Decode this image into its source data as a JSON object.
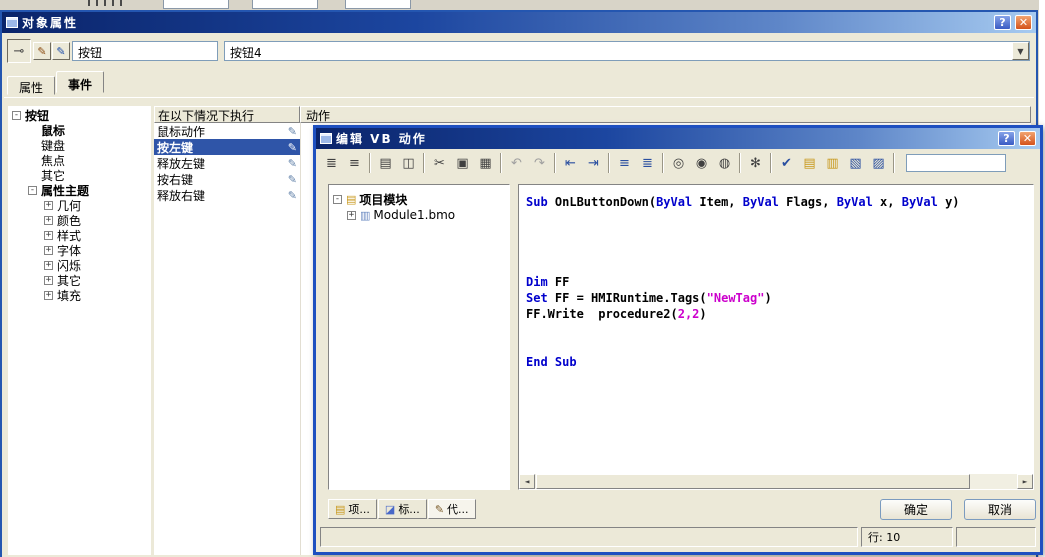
{
  "colors": {
    "titlebar_gradient_start": "#0A246A",
    "titlebar_gradient_end": "#A6CAF0",
    "selection_blue": "#2F55A8",
    "keyword_blue": "#0000CC",
    "string_magenta": "#CC00CC",
    "dialog_bg": "#ECE9D8"
  },
  "icons": {
    "help": "?",
    "close": "✕",
    "pin": "⊸",
    "pen": "✎",
    "dropdown": "▼",
    "action_pen": "✎",
    "scroll_left": "◄",
    "scroll_right": "►"
  },
  "main_window": {
    "title": "对象属性",
    "toolbar": {
      "object_type_value": "按钮",
      "object_select_value": "按钮4"
    },
    "tabs": [
      {
        "name": "tab-properties",
        "label": "属性",
        "active": false
      },
      {
        "name": "tab-events",
        "label": "事件",
        "active": true
      }
    ],
    "tree": [
      {
        "label": "按钮",
        "level": 0,
        "expander": "minus",
        "bold": true
      },
      {
        "label": "鼠标",
        "level": 1,
        "expander": "none",
        "bold": true
      },
      {
        "label": "键盘",
        "level": 1,
        "expander": "none",
        "bold": false
      },
      {
        "label": "焦点",
        "level": 1,
        "expander": "none",
        "bold": false
      },
      {
        "label": "其它",
        "level": 1,
        "expander": "none",
        "bold": false
      },
      {
        "label": "属性主题",
        "level": 1,
        "expander": "minus",
        "bold": true
      },
      {
        "label": "几何",
        "level": 2,
        "expander": "plus",
        "bold": false
      },
      {
        "label": "颜色",
        "level": 2,
        "expander": "plus",
        "bold": false
      },
      {
        "label": "样式",
        "level": 2,
        "expander": "plus",
        "bold": false
      },
      {
        "label": "字体",
        "level": 2,
        "expander": "plus",
        "bold": false
      },
      {
        "label": "闪烁",
        "level": 2,
        "expander": "plus",
        "bold": false
      },
      {
        "label": "其它",
        "level": 2,
        "expander": "plus",
        "bold": false
      },
      {
        "label": "填充",
        "level": 2,
        "expander": "plus",
        "bold": false
      }
    ],
    "event_table": {
      "col1": "在以下情况下执行",
      "col2": "动作",
      "rows": [
        {
          "label": "鼠标动作",
          "selected": false
        },
        {
          "label": "按左键",
          "selected": true
        },
        {
          "label": "释放左键",
          "selected": false
        },
        {
          "label": "按右键",
          "selected": false
        },
        {
          "label": "释放右键",
          "selected": false
        }
      ]
    }
  },
  "vb_dialog": {
    "title": "编辑 VB 动作",
    "toolbar_icons": [
      {
        "name": "page-setup-icon",
        "glyph": "≣",
        "color": "#404040"
      },
      {
        "name": "view-list-icon",
        "glyph": "≡",
        "color": "#404040"
      },
      {
        "sep": true
      },
      {
        "name": "print-icon",
        "glyph": "▤",
        "color": "#404040"
      },
      {
        "name": "print-preview-icon",
        "glyph": "◫",
        "color": "#404040"
      },
      {
        "sep": true
      },
      {
        "name": "cut-icon",
        "glyph": "✂",
        "color": "#404040"
      },
      {
        "name": "copy-icon",
        "glyph": "▣",
        "color": "#404040"
      },
      {
        "name": "paste-icon",
        "glyph": "▦",
        "color": "#404040"
      },
      {
        "sep": true
      },
      {
        "name": "undo-icon",
        "glyph": "↶",
        "color": "#A0A0A0"
      },
      {
        "name": "redo-icon",
        "glyph": "↷",
        "color": "#A0A0A0"
      },
      {
        "sep": true
      },
      {
        "name": "outdent-icon",
        "glyph": "⇤",
        "color": "#2A4FA0"
      },
      {
        "name": "indent-icon",
        "glyph": "⇥",
        "color": "#2A4FA0"
      },
      {
        "sep": true
      },
      {
        "name": "align-left-icon",
        "glyph": "≡",
        "color": "#2A4FA0"
      },
      {
        "name": "format-code-icon",
        "glyph": "≣",
        "color": "#2A4FA0"
      },
      {
        "sep": true
      },
      {
        "name": "find-icon",
        "glyph": "◎",
        "color": "#404040"
      },
      {
        "name": "find-next-icon",
        "glyph": "◉",
        "color": "#404040"
      },
      {
        "name": "find-replace-icon",
        "glyph": "◍",
        "color": "#404040"
      },
      {
        "sep": true
      },
      {
        "name": "tools-icon",
        "glyph": "✻",
        "color": "#404040"
      },
      {
        "sep": true
      },
      {
        "name": "syntax-check-icon",
        "glyph": "✔",
        "color": "#2A4FA0"
      },
      {
        "name": "export-module-icon",
        "glyph": "▤",
        "color": "#C8981C"
      },
      {
        "name": "import-module-icon",
        "glyph": "▥",
        "color": "#C8981C"
      },
      {
        "name": "import-action-icon",
        "glyph": "▧",
        "color": "#2A4FA0"
      },
      {
        "name": "export-action-icon",
        "glyph": "▨",
        "color": "#2A4FA0"
      },
      {
        "sep": true
      }
    ],
    "module_tree": [
      {
        "label": "项目模块",
        "level": 0,
        "expander": "minus",
        "icon": "▤",
        "icon_color": "#C8981C",
        "bold": true
      },
      {
        "label": "Module1.bmo",
        "level": 1,
        "expander": "plus",
        "icon": "▥",
        "icon_color": "#6888C0",
        "bold": false
      }
    ],
    "code_lines": [
      [
        {
          "t": "Sub",
          "c": "#0000CC"
        },
        {
          "t": " OnLButtonDown(",
          "c": "#000000"
        },
        {
          "t": "ByVal",
          "c": "#0000CC"
        },
        {
          "t": " Item, ",
          "c": "#000000"
        },
        {
          "t": "ByVal",
          "c": "#0000CC"
        },
        {
          "t": " Flags, ",
          "c": "#000000"
        },
        {
          "t": "ByVal",
          "c": "#0000CC"
        },
        {
          "t": " x, ",
          "c": "#000000"
        },
        {
          "t": "ByVal",
          "c": "#0000CC"
        },
        {
          "t": " y)",
          "c": "#000000"
        }
      ],
      [],
      [],
      [],
      [],
      [
        {
          "t": "Dim",
          "c": "#0000CC"
        },
        {
          "t": " FF",
          "c": "#000000"
        }
      ],
      [
        {
          "t": "Set",
          "c": "#0000CC"
        },
        {
          "t": " FF = HMIRuntime.Tags(",
          "c": "#000000"
        },
        {
          "t": "\"NewTag\"",
          "c": "#CC00CC"
        },
        {
          "t": ")",
          "c": "#000000"
        }
      ],
      [
        {
          "t": "FF.Write  procedure2(",
          "c": "#000000"
        },
        {
          "t": "2,2",
          "c": "#CC00CC"
        },
        {
          "t": ")",
          "c": "#000000"
        }
      ],
      [],
      [],
      [
        {
          "t": "End Sub",
          "c": "#0000CC"
        }
      ]
    ],
    "bottom_tabs": [
      {
        "name": "tab-project-view",
        "label": "项...",
        "icon": "▤",
        "icon_color": "#C8981C",
        "active": false
      },
      {
        "name": "tab-tags-view",
        "label": "标...",
        "icon": "◪",
        "icon_color": "#4868C8",
        "active": false
      },
      {
        "name": "tab-code-view",
        "label": "代...",
        "icon": "✎",
        "icon_color": "#7A5A28",
        "active": true
      }
    ],
    "ok_label": "确定",
    "cancel_label": "取消",
    "status_line": "行: 10"
  }
}
